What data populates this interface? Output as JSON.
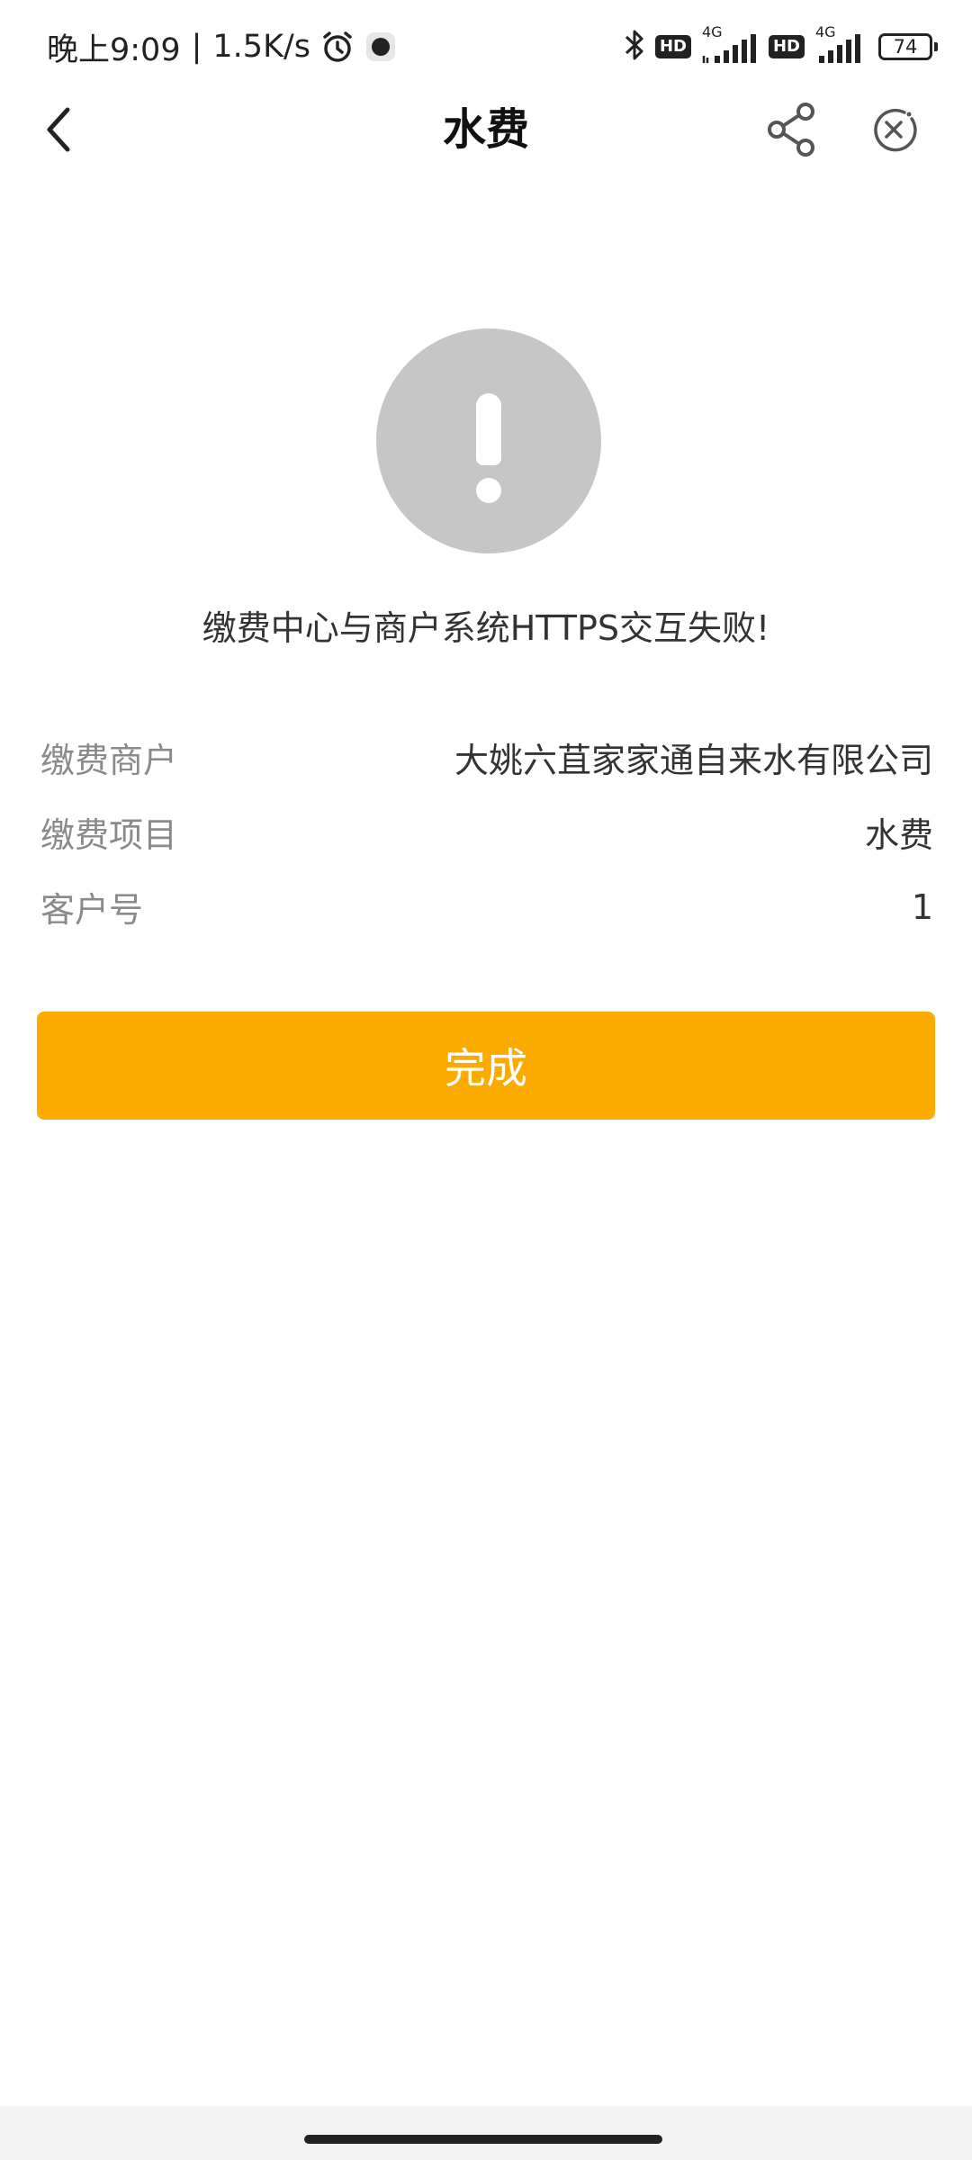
{
  "status_bar": {
    "time": "晚上9:09",
    "separator": "|",
    "net_speed": "1.5K/s",
    "hd1": "HD",
    "net1": "4G",
    "hd2": "HD",
    "net2": "4G",
    "battery": "74"
  },
  "header": {
    "title": "水费"
  },
  "result": {
    "message": "缴费中心与商户系统HTTPS交互失败!"
  },
  "details": [
    {
      "label": "缴费商户",
      "value": "大姚六苴家家通自来水有限公司"
    },
    {
      "label": "缴费项目",
      "value": "水费"
    },
    {
      "label": "客户号",
      "value": "1"
    }
  ],
  "actions": {
    "done_label": "完成"
  }
}
